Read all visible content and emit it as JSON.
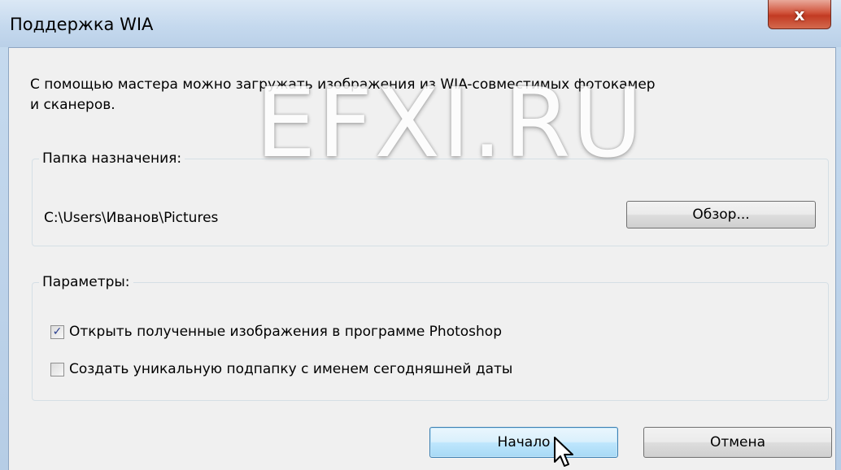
{
  "window": {
    "title": "Поддержка WIA",
    "close_label": "x"
  },
  "intro_text": "С помощью мастера можно загружать изображения из WIA-совместимых фотокамер\n и сканеров.",
  "destination": {
    "group_label": "Папка назначения:",
    "path": "C:\\Users\\Иванов\\Pictures",
    "browse_label": "Обзор..."
  },
  "options": {
    "group_label": "Параметры:",
    "items": [
      {
        "label": "Открыть полученные изображения в программе Photoshop",
        "checked": true
      },
      {
        "label": "Создать уникальную подпапку с именем сегодняшней даты",
        "checked": false
      }
    ]
  },
  "buttons": {
    "start_label": "Начало",
    "cancel_label": "Отмена"
  },
  "watermark_text": "EFXI.RU",
  "icons": {
    "close": "close-icon",
    "check": "checkmark-icon",
    "cursor": "mouse-pointer-icon"
  }
}
